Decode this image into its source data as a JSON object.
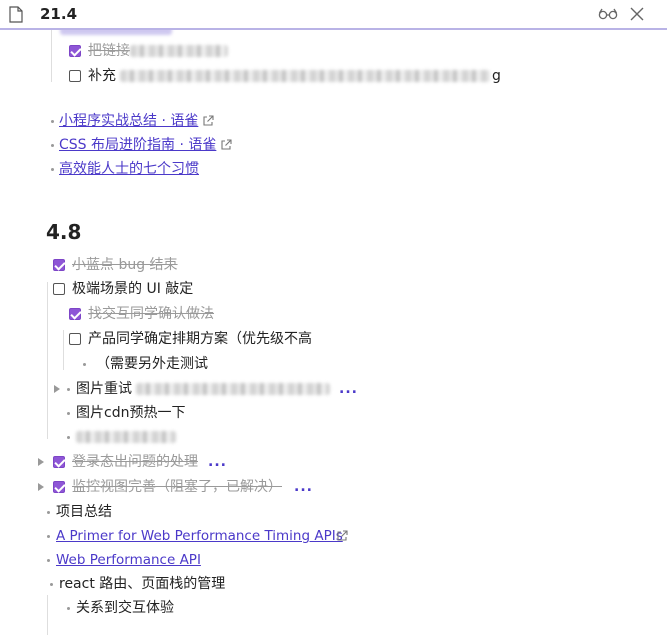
{
  "window": {
    "title": "21.4"
  },
  "partial_top": {
    "text": "…"
  },
  "list_a": {
    "item1": "把链接",
    "item2": "补充",
    "item2_tail": "g"
  },
  "links": [
    {
      "label": "小程序实战总结 · 语雀"
    },
    {
      "label": "CSS 布局进阶指南 · 语雀"
    },
    {
      "label": "高效能人士的七个习惯"
    }
  ],
  "section": {
    "heading": "4.8",
    "items": {
      "bug": "小蓝点 bug 结束",
      "ui": "极端场景的 UI 敲定",
      "ui_sub1": "找交互同学确认做法",
      "ui_sub2": "产品同学确定排期方案（优先级不高",
      "ui_sub2_child": "（需要另外走测试",
      "img_retry": "图片重试",
      "img_cdn": "图片cdn预热一下",
      "login": "登录态出问题的处理",
      "monitor": "监控视图完善（阻塞了，已解决）",
      "summary": "项目总结",
      "primer": "A Primer for Web Performance Timing APIs",
      "webperf": "Web Performance API",
      "react": "react 路由、页面栈的管理",
      "react_child": "关系到交互体验"
    },
    "ellipsis": "..."
  },
  "colors": {
    "accent": "#8e56d6",
    "link": "#4b39c9",
    "title_border": "#b9b3e6"
  }
}
